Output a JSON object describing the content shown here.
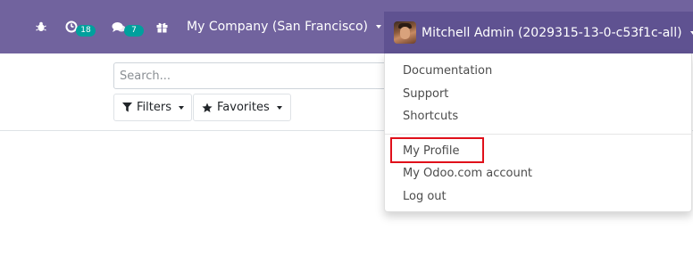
{
  "navbar": {
    "activities_badge": "18",
    "messages_badge": "7",
    "company": "My Company (San Francisco)",
    "user": "Mitchell Admin (2029315-13-0-c53f1c-all)"
  },
  "search": {
    "placeholder": "Search..."
  },
  "filters": {
    "filters_label": "Filters",
    "favorites_label": "Favorites"
  },
  "user_menu": {
    "items": [
      "Documentation",
      "Support",
      "Shortcuts",
      "My Profile",
      "My Odoo.com account",
      "Log out"
    ]
  },
  "colors": {
    "navbar": "#71639e",
    "badge": "#00a09d",
    "highlight": "#e0101a"
  }
}
